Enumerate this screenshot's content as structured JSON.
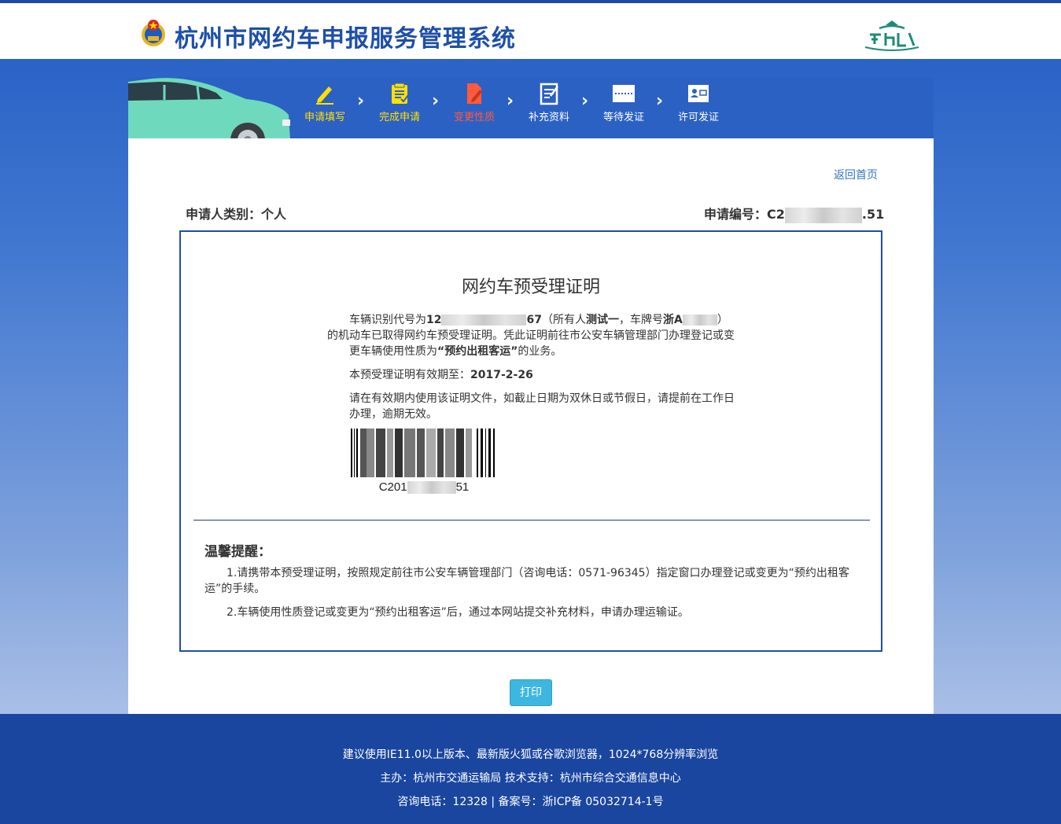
{
  "header": {
    "title": "杭州市网约车申报服务管理系统"
  },
  "steps": [
    {
      "label": "申请填写",
      "icon": "pencil-icon",
      "color": "#ffe000"
    },
    {
      "label": "完成申请",
      "icon": "clipboard-icon",
      "color": "#ffe000"
    },
    {
      "label": "变更性质",
      "icon": "document-edit-icon",
      "color": "#ff5a3c"
    },
    {
      "label": "补充资料",
      "icon": "notepad-icon",
      "color": "#ffffff"
    },
    {
      "label": "等待发证",
      "icon": "waiting-card-icon",
      "color": "#ffffff"
    },
    {
      "label": "许可发证",
      "icon": "id-card-icon",
      "color": "#ffffff"
    }
  ],
  "main": {
    "home_link": "返回首页",
    "applicant_type": "申请人类别：个人",
    "app_no_prefix": "申请编号：C2",
    "app_no_suffix": ".51"
  },
  "certificate": {
    "title": "网约车预受理证明",
    "vin_label": "车辆识别代号为",
    "vin_prefix": "12",
    "vin_suffix": "67",
    "owner_open": "（所有人",
    "owner_name": "测试一",
    "plate_label": "，车牌号",
    "plate_prefix": "浙A",
    "close_paren": "）",
    "line2a": "的机动车已取得网约车预受理证明。凭此证明前往市公安车辆管理部门办理登记或变更车辆使用性质为",
    "usage": "“预约出租客运”",
    "line2b": "的业务。",
    "validity_label": "本预受理证明有效期至：",
    "validity_date": "2017-2-26",
    "notice": "请在有效期内使用该证明文件，如截止日期为双休日或节假日，请提前在工作日办理，逾期无效。",
    "barcode_prefix": "C201",
    "barcode_suffix": "51"
  },
  "tips": {
    "title": "温馨提醒：",
    "items": [
      "1.请携带本预受理证明，按照规定前往市公安车辆管理部门（咨询电话：0571-96345）指定窗口办理登记或变更为“预约出租客运”的手续。",
      "2.车辆使用性质登记或变更为“预约出租客运”后，通过本网站提交补充材料，申请办理运输证。"
    ]
  },
  "actions": {
    "print_label": "打印"
  },
  "footer": {
    "line1": "建议使用IE11.0以上版本、最新版火狐或谷歌浏览器，1024*768分辨率浏览",
    "line2": "主办：杭州市交通运输局  技术支持：杭州市综合交通信息中心",
    "line3": "咨询电话：12328 | 备案号：浙ICP备 05032714-1号"
  },
  "colors": {
    "brand_blue": "#1e4fa8",
    "step_active": "#ff5a3c",
    "step_done": "#ffe000",
    "print_button": "#3eb7e0"
  }
}
